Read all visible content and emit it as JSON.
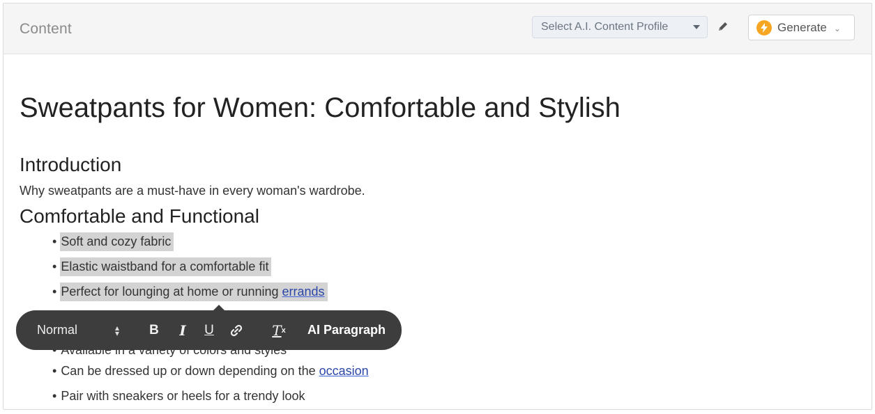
{
  "header": {
    "title": "Content",
    "profile_select": {
      "value": "Select A.I. Content Profile"
    },
    "generate_label": "Generate"
  },
  "document": {
    "title": "Sweatpants for Women: Comfortable and Stylish",
    "sections": [
      {
        "heading": "Introduction",
        "text": "Why sweatpants are a must-have in every woman's wardrobe."
      },
      {
        "heading": "Comfortable and Functional"
      }
    ],
    "bullets": [
      {
        "text": "Soft and cozy fabric"
      },
      {
        "text": "Elastic waistband for a comfortable fit"
      },
      {
        "text_before": "Perfect for lounging at home or running ",
        "text_spell": "errands"
      },
      {
        "text": "Available in a variety of colors and styles"
      },
      {
        "text_before": "Can be dressed up or down depending on the ",
        "text_spell": "occasion"
      },
      {
        "text": "Pair with sneakers or heels for a trendy look"
      }
    ]
  },
  "toolbar": {
    "format_value": "Normal",
    "bold_label": "B",
    "italic_label": "I",
    "underline_label": "U",
    "clear_label": "T",
    "clear_sub": "x",
    "ai_paragraph_label": "AI Paragraph"
  },
  "colors": {
    "accent_bolt": "#f5a623",
    "selection": "#d3d3d3",
    "toolbar_bg": "#3d3d3d",
    "spellcheck_underline": "#3f63d6"
  }
}
